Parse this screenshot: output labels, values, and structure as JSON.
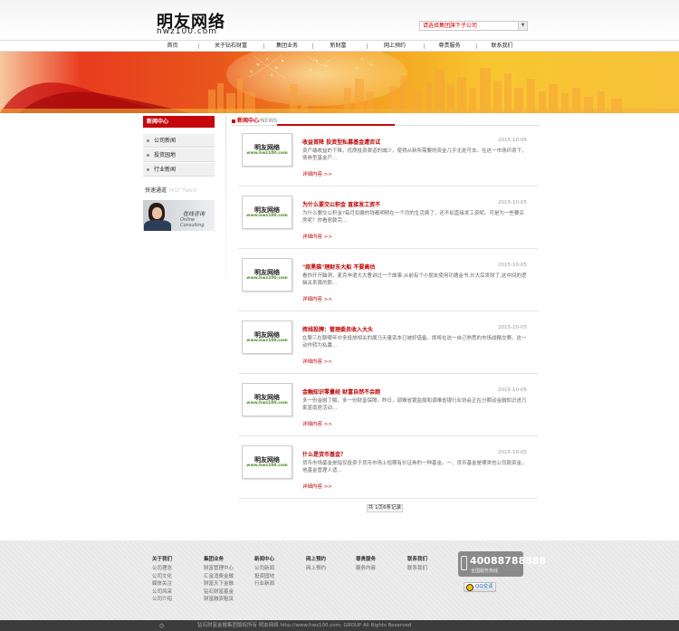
{
  "header": {
    "logo": "明友网络",
    "logo_sub": "hwz100.com",
    "branch_select": "请选择集团旗下子公司"
  },
  "nav": [
    "首页",
    "关于钻石财富",
    "集团业务",
    "新财富",
    "网上预约",
    "尊贵服务",
    "联系我们"
  ],
  "sidebar": {
    "title": "新闻中心",
    "items": [
      "公司新闻",
      "投资园地",
      "行业新闻"
    ],
    "fast_track": "快速通道",
    "fast_track_en": "FAST TRACK",
    "consult_label": "在线咨询",
    "consult_en": "Online Consulting"
  },
  "main": {
    "title": "新闻中心",
    "title_en": "/NEWS",
    "thumb_name": "明友网络",
    "thumb_url": "www.hwz100.com",
    "more_label": "详细内容 >>",
    "articles": [
      {
        "title": "收益首降 投资型私募基金遭否试",
        "date": "2015-10-05",
        "desc": "资产端收益的下降，优质投资渠道的减少，使得从新所需要的资金几乎无处可去。在这一市场环境下，债券型基金产..."
      },
      {
        "title": "为什么要交公积金 直接发工资不",
        "date": "2015-10-05",
        "desc": "为什么要交公积金?每月扣缴的钱都明明在一个月的生活费了，还不如直接发工资呢。可是为一些要买房呢？你看居款完..."
      },
      {
        "title": "\"叔黑猫\"理财东大船 不要高估",
        "date": "2015-10-05",
        "desc": "看你开开脑洞，麦克申遣大大曹讲过一个故事:从前有个小朋友使用功德金书,长大后发财了,这中间的逻辑关系算的那..."
      },
      {
        "title": "挥线投牌：管理委员收入大头",
        "date": "2015-10-05",
        "desc": "在聊三在聊哪年中多投放相关的属马天量资本已被好借备，即将在这一自己熟悉的市场战略交赛。这一动作转为私募..."
      },
      {
        "title": "金融知识零量经 财富自然不会跑",
        "date": "2015-10-05",
        "desc": "多一份金融了解，多一份财富保障。昨日，调难省银监局和调难省银行业协会正在分期动金融知识进万家蓝南居活动..."
      },
      {
        "title": "什么是货币基金？",
        "date": "2015-10-05",
        "desc": "货币市场基金是指仅投资于货币市场上短期有价证券的一种基金。一、货币基金是哪类也公司款资金，他基金管理人适..."
      }
    ],
    "pager": "共 1页6条记录"
  },
  "footer": {
    "columns": [
      {
        "title": "关于我们",
        "items": [
          "公司理念",
          "公司文化",
          "媒体关注",
          "公司风采",
          "公司介绍"
        ]
      },
      {
        "title": "集团业务",
        "items": [
          "财富管理中心",
          "汇金消费金融",
          "财富天下金融",
          "钻石财富基金",
          "财富融资租赁"
        ]
      },
      {
        "title": "新闻中心",
        "items": [
          "公司新闻",
          "投资园地",
          "行业新闻"
        ]
      },
      {
        "title": "网上预约",
        "items": [
          "网上预约"
        ]
      },
      {
        "title": "尊贵服务",
        "items": [
          "服务内容"
        ]
      },
      {
        "title": "联系我们",
        "items": [
          "联系我们"
        ]
      }
    ],
    "hotline": "40088788888",
    "hotline_label": "全国服务热线",
    "qq": "QQ交谈"
  },
  "copyright": "钻石财富金融集团版权所有 明友网络 http://www.hwz100.com, GROUP All Rights Reserved"
}
